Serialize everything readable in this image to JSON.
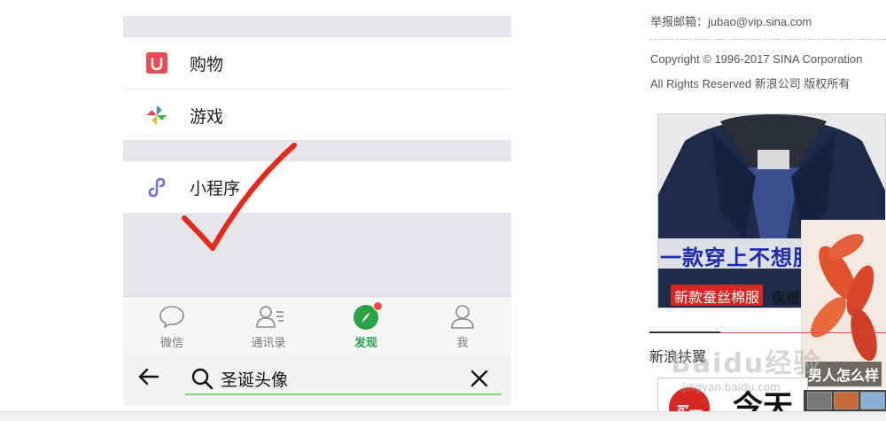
{
  "phone": {
    "menu": [
      {
        "label": "购物",
        "icon": "shopping-icon"
      },
      {
        "label": "游戏",
        "icon": "game-icon"
      },
      {
        "label": "小程序",
        "icon": "mini-program-icon"
      }
    ],
    "tabs": [
      {
        "label": "微信",
        "icon": "chat-bubble-icon",
        "active": false
      },
      {
        "label": "通讯录",
        "icon": "contacts-icon",
        "active": false
      },
      {
        "label": "发现",
        "icon": "compass-icon",
        "active": true
      },
      {
        "label": "我",
        "icon": "person-icon",
        "active": false
      }
    ],
    "search": {
      "query": "圣诞头像"
    },
    "colors": {
      "accent_green": "#2ba245",
      "badge_red": "#f24a3b",
      "annotation_red": "#e32b1c"
    }
  },
  "sidebar": {
    "report_email": "举报邮箱：jubao@vip.sina.com",
    "copyright": "Copyright © 1996-2017 SINA Corporation",
    "rights": "All Rights Reserved 新浪公司 版权所有",
    "ad_headline": "一款穿上不想脱",
    "ad_tag": "新款蚕丝棉服",
    "ad_tag_suffix": "保暖",
    "ad2_caption": "男人怎么样",
    "section_title": "新浪扶翼",
    "ad3_badge": "买一",
    "ad3_big": "今天"
  },
  "watermark": {
    "text": "Baidu经验",
    "url": "jingyan.baidu.com"
  }
}
